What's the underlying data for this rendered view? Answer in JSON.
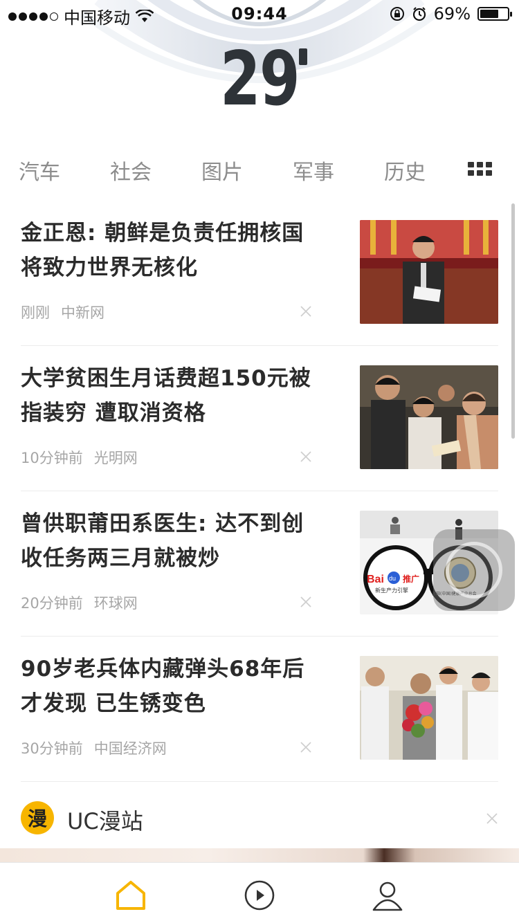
{
  "status_bar": {
    "carrier": "中国移动",
    "time": "09:44",
    "battery": "69%",
    "battery_level": 0.69,
    "signal_bars_filled": 4,
    "signal_bars_total": 5
  },
  "weather": {
    "temperature": "29"
  },
  "tabs": [
    "汽车",
    "社会",
    "图片",
    "军事",
    "历史"
  ],
  "articles": [
    {
      "title": "金正恩: 朝鲜是负责任拥核国将致力世界无核化",
      "time": "刚刚",
      "source": "中新网"
    },
    {
      "title": "大学贫困生月话费超150元被指装穷 遭取消资格",
      "time": "10分钟前",
      "source": "光明网"
    },
    {
      "title": "曾供职莆田系医生: 达不到创收任务两三月就被炒",
      "time": "20分钟前",
      "source": "环球网"
    },
    {
      "title": "90岁老兵体内藏弹头68年后才发现 已生锈变色",
      "time": "30分钟前",
      "source": "中国经济网"
    }
  ],
  "thumb_texts": {
    "baidu_brand": "Bai",
    "baidu_du": "du",
    "baidu_promo": "推广",
    "baidu_slogan": "新生产力引擎",
    "putian_caption": "莆田(中国)健康产业总会"
  },
  "section": {
    "logo_char": "漫",
    "label": "UC漫站"
  },
  "colors": {
    "accent": "#f7b500",
    "title_text": "#2b2b2b",
    "meta_text": "#a6a6a6",
    "tab_text": "#8c8c8c",
    "temperature": "#2e3338"
  }
}
